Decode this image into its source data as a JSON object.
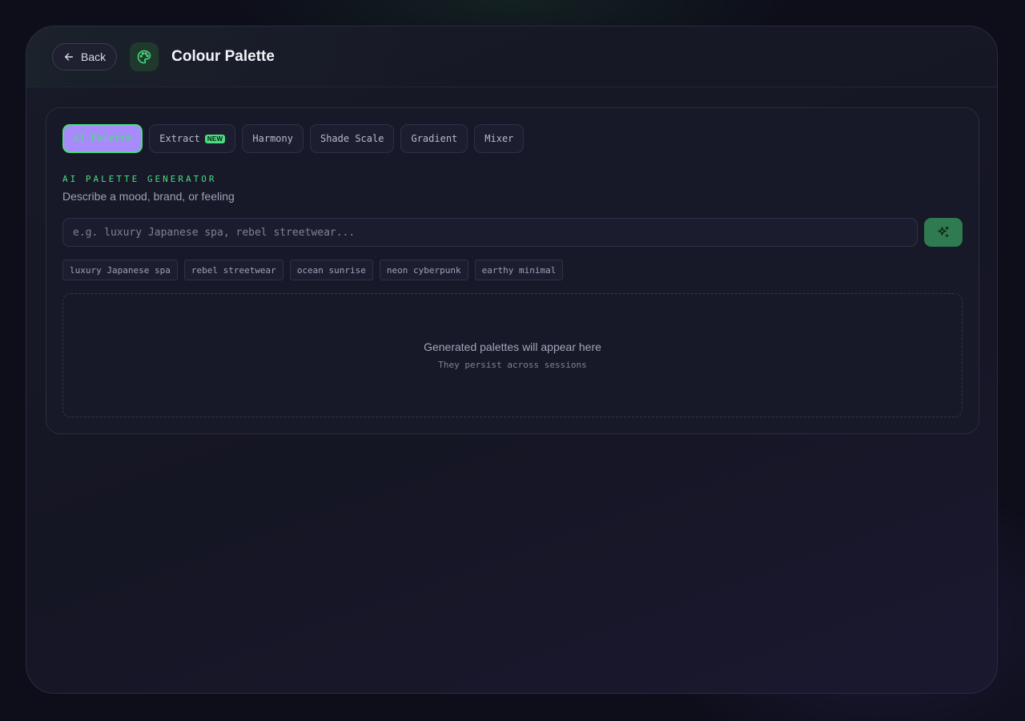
{
  "header": {
    "back_label": "Back",
    "title": "Colour Palette",
    "app_icon": "palette-icon"
  },
  "tabs": [
    {
      "label": "AI Palette",
      "active": true
    },
    {
      "label": "Extract",
      "badge": "NEW",
      "active": false
    },
    {
      "label": "Harmony",
      "active": false
    },
    {
      "label": "Shade Scale",
      "active": false
    },
    {
      "label": "Gradient",
      "active": false
    },
    {
      "label": "Mixer",
      "active": false
    }
  ],
  "generator": {
    "section_label": "AI PALETTE GENERATOR",
    "subtitle": "Describe a mood, brand, or feeling",
    "input_value": "",
    "input_placeholder": "e.g. luxury Japanese spa, rebel streetwear...",
    "generate_icon": "sparkles-icon"
  },
  "suggestions": [
    "luxury Japanese spa",
    "rebel streetwear",
    "ocean sunrise",
    "neon cyberpunk",
    "earthy minimal"
  ],
  "empty_state": {
    "title": "Generated palettes will appear here",
    "subtitle": "They persist across sessions"
  },
  "colors": {
    "accent_green": "#4ade80",
    "active_tab_bg": "#a78bfa",
    "generate_button": "#2f7a50",
    "background": "#0d0e1a"
  }
}
